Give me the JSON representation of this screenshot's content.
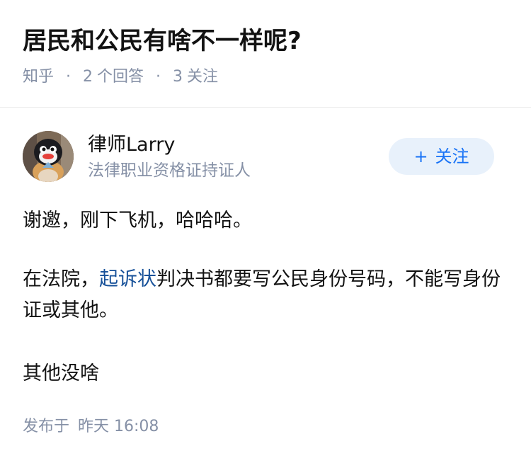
{
  "question": {
    "title": "居民和公民有啥不一样呢?",
    "source": "知乎",
    "answer_count": "2",
    "answer_label": "个回答",
    "follow_count": "3",
    "follow_label": "关注"
  },
  "author": {
    "name": "律师Larry",
    "badge": "法律职业资格证持证人",
    "avatar_icon": "pingu-penguin-avatar",
    "follow_button": "关注",
    "follow_plus": "+"
  },
  "answer": {
    "p1": "谢邀，刚下飞机，哈哈哈。",
    "p2_before": "在法院，",
    "p2_link": "起诉状",
    "p2_after": "判决书都要写公民身份号码，不能写身份证或其他。",
    "p3": "其他没啥"
  },
  "publish": {
    "label": "发布于",
    "time": "昨天 16:08"
  },
  "colors": {
    "link": "#175199",
    "follow_text": "#1772f6",
    "follow_bg": "#e8f1fb",
    "meta_gray": "#8590a6"
  }
}
